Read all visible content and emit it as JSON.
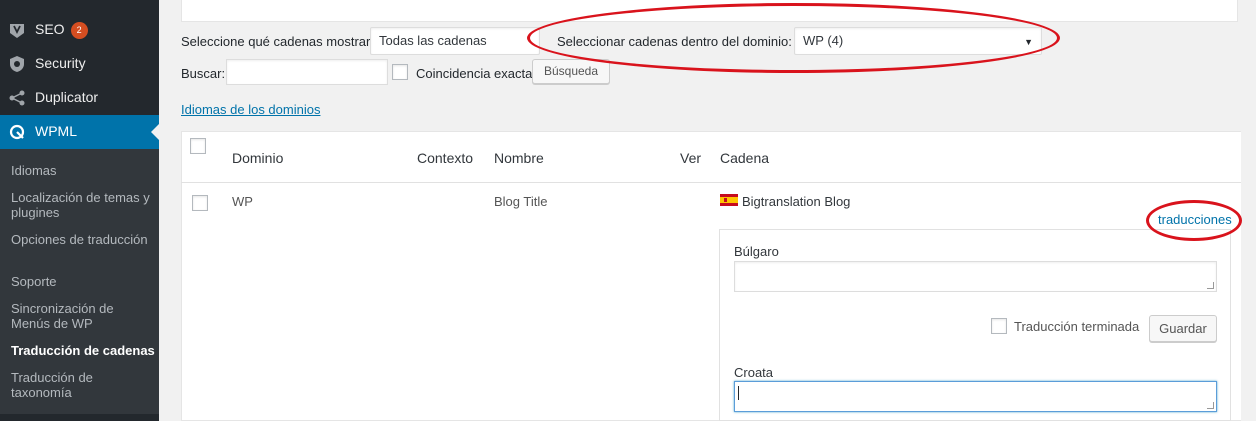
{
  "sidebar": {
    "items": [
      {
        "label": "SEO",
        "badge": "2",
        "icon": "yoast-icon"
      },
      {
        "label": "Security",
        "icon": "shield-icon"
      },
      {
        "label": "Duplicator",
        "icon": "share-icon"
      },
      {
        "label": "WPML",
        "icon": "wpml-icon"
      }
    ],
    "submenu": [
      "Idiomas",
      "Localización de temas y plugines",
      "Opciones de traducción",
      "Soporte",
      "Sincronización de Menús de WP",
      "Traducción de cadenas",
      "Traducción de taxonomía"
    ],
    "current_submenu": "Traducción de cadenas",
    "accent_color": "#0073aa"
  },
  "filters": {
    "show_label": "Seleccione qué cadenas mostrar",
    "show_value": "Todas las cadenas",
    "domain_label": "Seleccionar cadenas dentro del dominio:",
    "domain_value": "WP (4)",
    "search_label": "Buscar:",
    "search_value": "",
    "exact_match_label": "Coincidencia exacta",
    "search_button": "Búsqueda",
    "domain_languages_link": "Idiomas de los dominios"
  },
  "table": {
    "headers": [
      "Dominio",
      "Contexto",
      "Nombre",
      "Ver",
      "Cadena"
    ],
    "rows": [
      {
        "domain": "WP",
        "context": "",
        "name": "Blog Title",
        "string": "Bigtranslation Blog",
        "flag": "es-flag-icon",
        "translations_link": "traducciones"
      }
    ]
  },
  "translations": {
    "lang1": "Búlgaro",
    "lang1_value": "",
    "done_label": "Traducción terminada",
    "save_button": "Guardar",
    "lang2": "Croata",
    "lang2_value": ""
  },
  "annotation_color": "#d9131c"
}
